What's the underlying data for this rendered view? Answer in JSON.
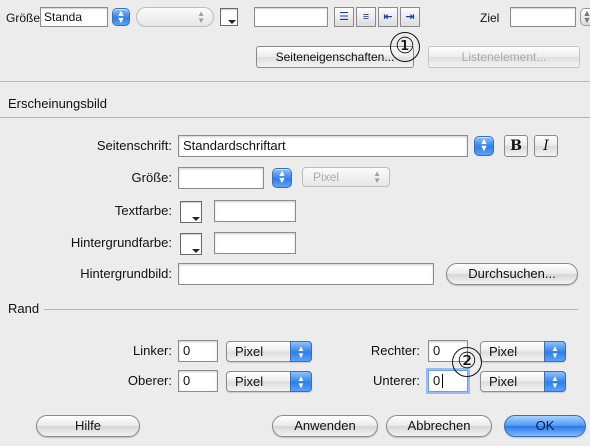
{
  "top": {
    "size_label": "Größe",
    "size_value": "Standa",
    "target_label": "Ziel",
    "page_props_button": "Seiteneigenschaften...",
    "list_item_button": "Listenelement..."
  },
  "callouts": [
    "①",
    "②"
  ],
  "appearance": {
    "section_title": "Erscheinungsbild",
    "font_label": "Seitenschrift:",
    "font_value": "Standardschriftart",
    "bold_label": "B",
    "italic_label": "I",
    "size_label": "Größe:",
    "size_unit": "Pixel",
    "text_color_label": "Textfarbe:",
    "bg_color_label": "Hintergrundfarbe:",
    "bg_image_label": "Hintergrundbild:",
    "browse_button": "Durchsuchen..."
  },
  "margin": {
    "section_title": "Rand",
    "left_label": "Linker:",
    "left_value": "0",
    "left_unit": "Pixel",
    "right_label": "Rechter:",
    "right_value": "0",
    "right_unit": "Pixel",
    "top_label": "Oberer:",
    "top_value": "0",
    "top_unit": "Pixel",
    "bottom_label": "Unterer:",
    "bottom_value": "0",
    "bottom_unit": "Pixel"
  },
  "buttons": {
    "help": "Hilfe",
    "apply": "Anwenden",
    "cancel": "Abbrechen",
    "ok": "OK"
  },
  "colors": {
    "accent_blue": "#2f7fe8",
    "panel_bg": "#ececec"
  }
}
